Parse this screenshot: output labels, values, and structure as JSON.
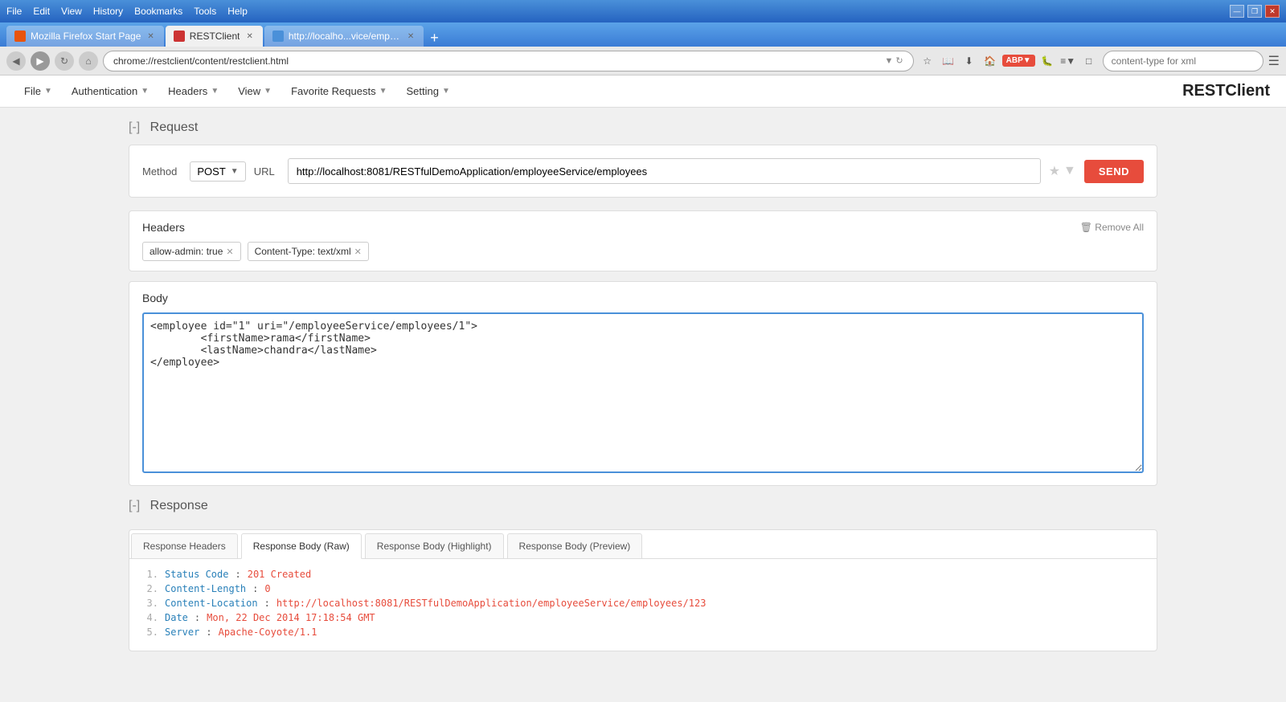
{
  "browser": {
    "menu_items": [
      "File",
      "Edit",
      "View",
      "History",
      "Bookmarks",
      "Tools",
      "Help"
    ],
    "tabs": [
      {
        "label": "Mozilla Firefox Start Page",
        "active": false,
        "favicon_color": "#e8540e"
      },
      {
        "label": "RESTClient",
        "active": true,
        "favicon_color": "#cc3333"
      },
      {
        "label": "http://localho...vice/employees",
        "active": false,
        "favicon_color": "#4a90d9"
      }
    ],
    "url": "chrome://restclient/content/restclient.html",
    "search_placeholder": "content-type for xml",
    "win_minimize": "—",
    "win_restore": "❐",
    "win_close": "✕"
  },
  "app": {
    "title": "RESTClient",
    "nav": [
      {
        "label": "File"
      },
      {
        "label": "Authentication"
      },
      {
        "label": "Headers"
      },
      {
        "label": "View"
      },
      {
        "label": "Favorite Requests"
      },
      {
        "label": "Setting"
      }
    ]
  },
  "request": {
    "section_toggle": "[-]",
    "section_label": "Request",
    "method_label": "Method",
    "method_value": "POST",
    "url_label": "URL",
    "url_value": "http://localhost:8081/RESTfulDemoApplication/employeeService/employees",
    "send_label": "SEND"
  },
  "headers": {
    "title": "Headers",
    "remove_all_label": "Remove All",
    "tags": [
      {
        "label": "allow-admin: true"
      },
      {
        "label": "Content-Type: text/xml"
      }
    ]
  },
  "body": {
    "title": "Body",
    "content": "<employee id=\"1\" uri=\"/employeeService/employees/1\">\n        <firstName>rama</firstName>\n        <lastName>chandra</lastName>\n</employee>"
  },
  "response": {
    "section_toggle": "[-]",
    "section_label": "Response",
    "tabs": [
      {
        "label": "Response Headers",
        "active": false
      },
      {
        "label": "Response Body (Raw)",
        "active": true
      },
      {
        "label": "Response Body (Highlight)",
        "active": false
      },
      {
        "label": "Response Body (Preview)",
        "active": false
      }
    ],
    "lines": [
      {
        "num": "1.",
        "key": "Status Code",
        "sep": ":",
        "val": "201 Created",
        "val_black": false
      },
      {
        "num": "2.",
        "key": "Content-Length",
        "sep": ":",
        "val": "0",
        "val_black": false
      },
      {
        "num": "3.",
        "key": "Content-Location",
        "sep": ":",
        "val": "http://localhost:8081/RESTfulDemoApplication/employeeService/employees/123",
        "val_black": false
      },
      {
        "num": "4.",
        "key": "Date",
        "sep": ":",
        "val": "Mon, 22 Dec 2014 17:18:54 GMT",
        "val_black": false
      },
      {
        "num": "5.",
        "key": "Server",
        "sep": ":",
        "val": "Apache-Coyote/1.1",
        "val_black": false
      }
    ]
  }
}
